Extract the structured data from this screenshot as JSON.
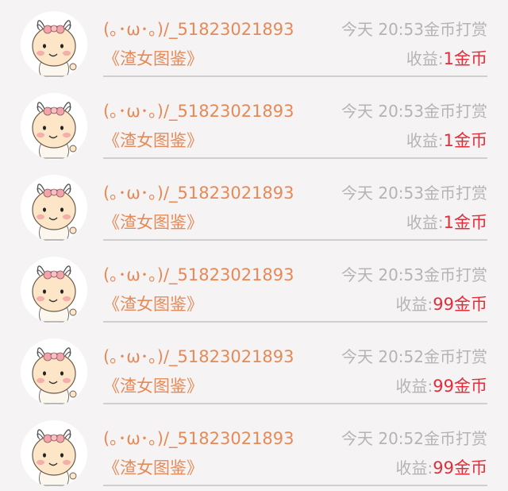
{
  "records": [
    {
      "user": "(｡･ω･｡)/_51823021893",
      "time": "今天 20:53",
      "action": "金币打赏",
      "title": "《渣女图鉴》",
      "earn_label": "收益:",
      "earn_value": "1金币"
    },
    {
      "user": "(｡･ω･｡)/_51823021893",
      "time": "今天 20:53",
      "action": "金币打赏",
      "title": "《渣女图鉴》",
      "earn_label": "收益:",
      "earn_value": "1金币"
    },
    {
      "user": "(｡･ω･｡)/_51823021893",
      "time": "今天 20:53",
      "action": "金币打赏",
      "title": "《渣女图鉴》",
      "earn_label": "收益:",
      "earn_value": "1金币"
    },
    {
      "user": "(｡･ω･｡)/_51823021893",
      "time": "今天 20:53",
      "action": "金币打赏",
      "title": "《渣女图鉴》",
      "earn_label": "收益:",
      "earn_value": "99金币"
    },
    {
      "user": "(｡･ω･｡)/_51823021893",
      "time": "今天 20:52",
      "action": "金币打赏",
      "title": "《渣女图鉴》",
      "earn_label": "收益:",
      "earn_value": "99金币"
    },
    {
      "user": "(｡･ω･｡)/_51823021893",
      "time": "今天 20:52",
      "action": "金币打赏",
      "title": "《渣女图鉴》",
      "earn_label": "收益:",
      "earn_value": "99金币"
    }
  ],
  "colors": {
    "name": "#e58a57",
    "meta": "#b4b4b4",
    "earn_value": "#e02e3a",
    "divider": "#cfcfcf",
    "background": "#f6f3f4"
  },
  "icons": {
    "avatar": "baby-avatar-icon"
  }
}
